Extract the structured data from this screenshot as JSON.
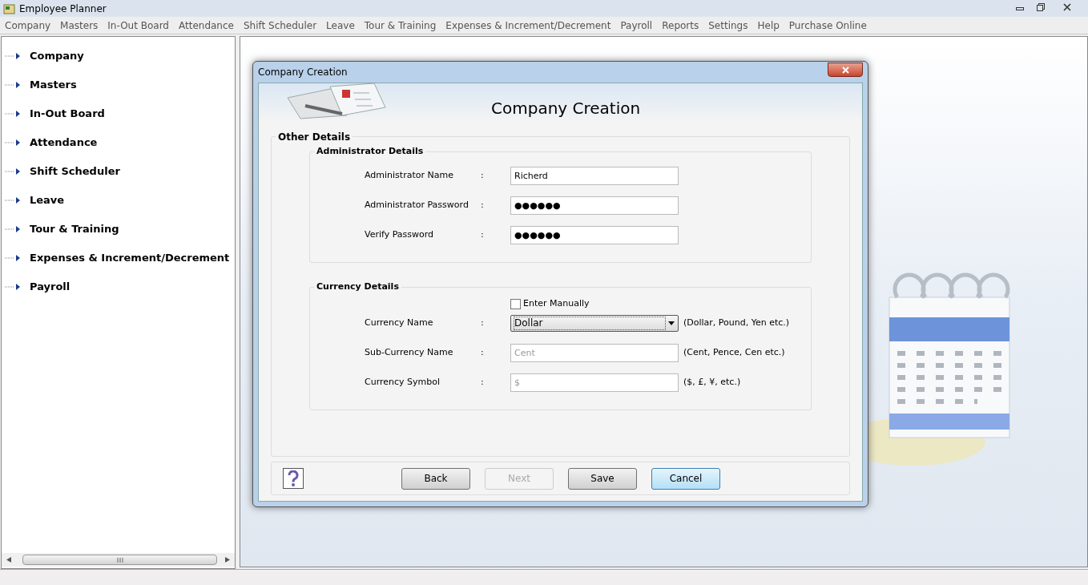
{
  "window": {
    "title": "Employee Planner"
  },
  "menu": [
    "Company",
    "Masters",
    "In-Out Board",
    "Attendance",
    "Shift Scheduler",
    "Leave",
    "Tour & Training",
    "Expenses & Increment/Decrement",
    "Payroll",
    "Reports",
    "Settings",
    "Help",
    "Purchase Online"
  ],
  "sidebar": {
    "items": [
      {
        "label": "Company",
        "expanded": false
      },
      {
        "label": "Masters",
        "expanded": false
      },
      {
        "label": "In-Out Board",
        "expanded": false
      },
      {
        "label": "Attendance",
        "expanded": false
      },
      {
        "label": "Shift Scheduler",
        "expanded": false
      },
      {
        "label": "Leave",
        "expanded": false
      },
      {
        "label": "Tour & Training",
        "expanded": false
      },
      {
        "label": "Expenses & Increment/Decrement",
        "expanded": false
      },
      {
        "label": "Payroll",
        "expanded": false
      }
    ]
  },
  "dialog": {
    "title": "Company Creation",
    "heading": "Company Creation",
    "group_title": "Other Details",
    "sections": [
      {
        "title": "Administrator Details",
        "fields": [
          {
            "kind": "text",
            "label": "Administrator Name",
            "separator": ":",
            "value": "Richerd"
          },
          {
            "kind": "text",
            "label": "Administrator Password",
            "separator": ":",
            "value": "●●●●●●"
          },
          {
            "kind": "text",
            "label": "Verify Password",
            "separator": ":",
            "value": "●●●●●●"
          }
        ]
      },
      {
        "title": "Currency Details",
        "checkbox": {
          "label": "Enter Manually",
          "checked": false
        },
        "fields": [
          {
            "kind": "select",
            "label": "Currency Name",
            "separator": ":",
            "value": "Dollar",
            "hint": "(Dollar, Pound, Yen etc.)"
          },
          {
            "kind": "text",
            "label": "Sub-Currency Name",
            "separator": ":",
            "placeholder": "Cent",
            "hint": "(Cent, Pence, Cen etc.)"
          },
          {
            "kind": "text",
            "label": "Currency Symbol",
            "separator": ":",
            "placeholder": "$",
            "hint": "($, £, ¥, etc.)"
          }
        ]
      }
    ],
    "buttons": [
      {
        "label": "Back",
        "disabled": false,
        "selected": false
      },
      {
        "label": "Next",
        "disabled": true,
        "selected": false
      },
      {
        "label": "Save",
        "disabled": false,
        "selected": false
      },
      {
        "label": "Cancel",
        "disabled": false,
        "selected": true
      }
    ]
  }
}
